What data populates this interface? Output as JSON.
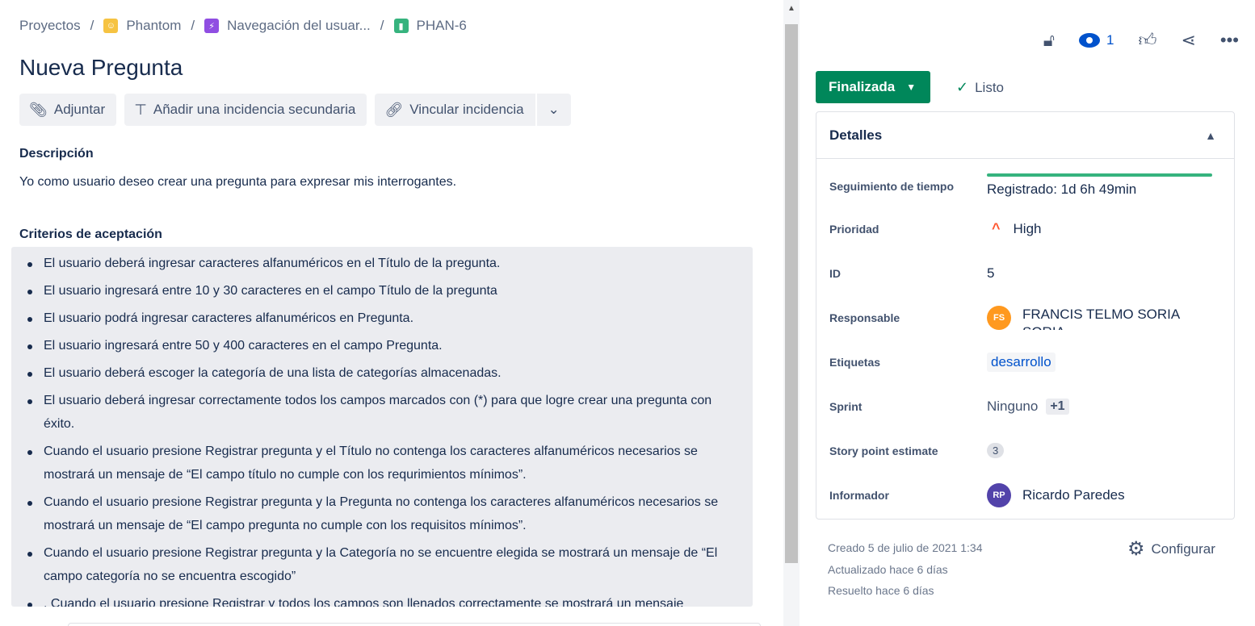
{
  "breadcrumb": {
    "projects": "Proyectos",
    "project": "Phantom",
    "epic": "Navegación del usuar...",
    "issue_key": "PHAN-6",
    "separator": "/"
  },
  "issue": {
    "title": "Nueva Pregunta"
  },
  "toolbar": {
    "attach": "Adjuntar",
    "add_child": "Añadir una incidencia secundaria",
    "link": "Vincular incidencia",
    "more": "⌄"
  },
  "description": {
    "heading": "Descripción",
    "text": "Yo como usuario deseo crear una pregunta para expresar mis interrogantes."
  },
  "criteria": {
    "heading": "Criterios de aceptación",
    "items": [
      "El usuario deberá ingresar caracteres alfanuméricos en el Título de la pregunta.",
      "El usuario ingresará entre 10 y 30 caracteres en el campo Título de la pregunta",
      "El usuario podrá ingresar caracteres alfanuméricos en Pregunta.",
      "El usuario ingresará entre 50 y 400 caracteres en el campo Pregunta.",
      "El usuario deberá escoger la categoría de una lista de categorías almacenadas.",
      "El usuario deberá ingresar correctamente todos los campos marcados con (*) para que logre crear una pregunta con éxito.",
      "Cuando el usuario presione Registrar pregunta y el Título no contenga los caracteres alfanuméricos necesarios se mostrará un mensaje de “El campo título no cumple con los requrimientos mínimos”.",
      "Cuando el usuario presione Registrar pregunta y  la Pregunta no contenga los caracteres alfanuméricos necesarios se mostrará un mensaje de “El campo pregunta no cumple con los requisitos mínimos”.",
      "Cuando el usuario presione Registrar pregunta y  la Categoría no se encuentre elegida se mostrará un mensaje de “El campo categoría no se encuentra escogido”",
      ". Cuando el usuario presione Registrar y todos los campos son llenados correctamente se mostrará un mensaje"
    ]
  },
  "actions": {
    "watchers_count": "1"
  },
  "status": {
    "label": "Finalizada",
    "resolution": "Listo",
    "color": "#00875a"
  },
  "details": {
    "heading": "Detalles",
    "time_tracking": {
      "label": "Seguimiento de tiempo",
      "value": "Registrado: 1d 6h 49min"
    },
    "priority": {
      "label": "Prioridad",
      "value": "High"
    },
    "id": {
      "label": "ID",
      "value": "5"
    },
    "assignee": {
      "label": "Responsable",
      "initials": "FS",
      "name": "FRANCIS TELMO SORIA SORIA"
    },
    "labels": {
      "label": "Etiquetas",
      "value": "desarrollo"
    },
    "sprint": {
      "label": "Sprint",
      "value": "Ninguno",
      "extra": "+1"
    },
    "story_points": {
      "label": "Story point estimate",
      "value": "3"
    },
    "reporter": {
      "label": "Informador",
      "initials": "RP",
      "name": "Ricardo Paredes"
    }
  },
  "meta": {
    "created": "Creado 5 de julio de 2021 1:34",
    "updated": "Actualizado hace 6 días",
    "resolved": "Resuelto hace 6 días",
    "configure": "Configurar"
  }
}
